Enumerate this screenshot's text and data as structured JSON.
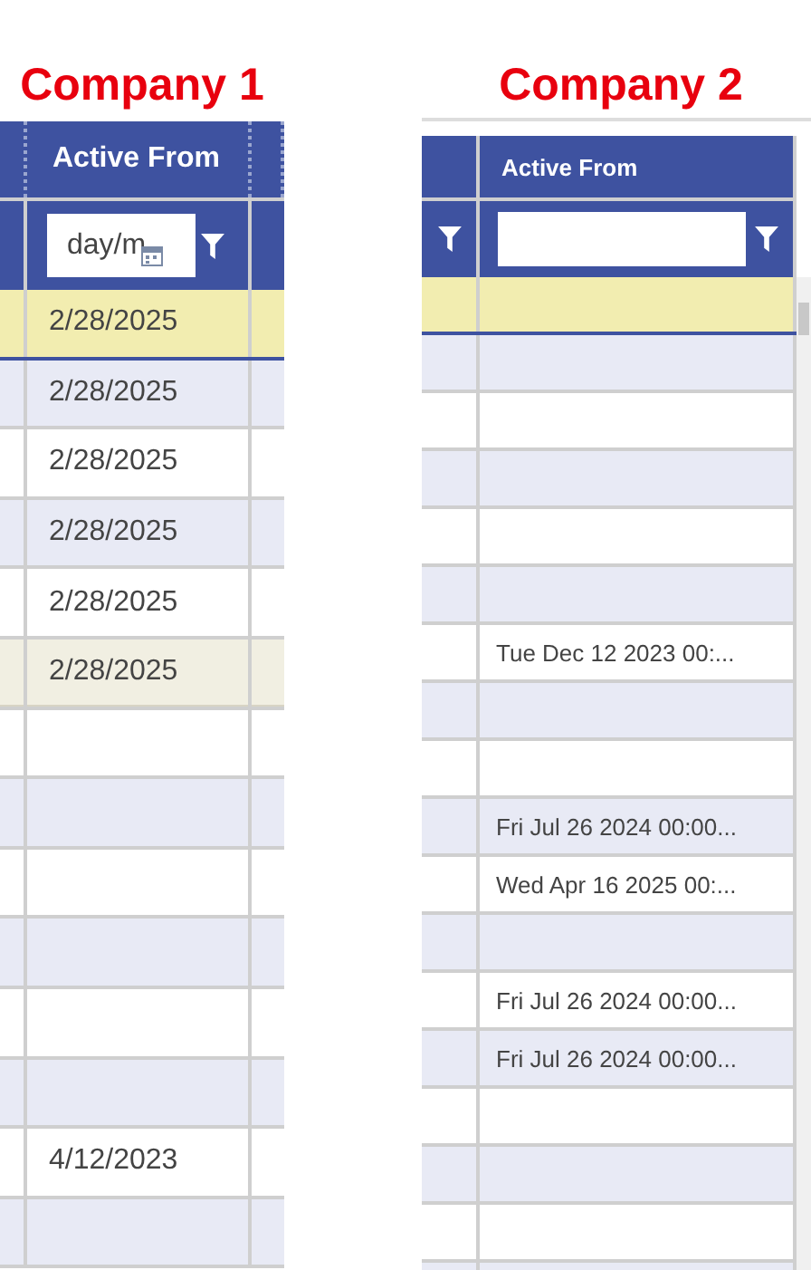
{
  "grids": [
    {
      "title": "Company 1",
      "columns": [
        {
          "label": "Active From"
        }
      ],
      "filter": {
        "kind": "date",
        "placeholder": "day/m"
      },
      "rows": [
        {
          "active_from": "2/28/2025",
          "selected": true,
          "hovered": false
        },
        {
          "active_from": "2/28/2025",
          "selected": false,
          "hovered": false
        },
        {
          "active_from": "2/28/2025",
          "selected": false,
          "hovered": false
        },
        {
          "active_from": "2/28/2025",
          "selected": false,
          "hovered": false
        },
        {
          "active_from": "2/28/2025",
          "selected": false,
          "hovered": false
        },
        {
          "active_from": "2/28/2025",
          "selected": false,
          "hovered": true
        },
        {
          "selected": false,
          "hovered": false
        },
        {
          "selected": false,
          "hovered": false
        },
        {
          "selected": false,
          "hovered": false
        },
        {
          "selected": false,
          "hovered": false
        },
        {
          "selected": false,
          "hovered": false
        },
        {
          "selected": false,
          "hovered": false
        },
        {
          "active_from": "4/12/2023",
          "selected": false,
          "hovered": false
        },
        {
          "selected": false,
          "hovered": false
        }
      ]
    },
    {
      "title": "Company 2",
      "columns": [
        {
          "label": "Active From"
        }
      ],
      "filter": {
        "kind": "text"
      },
      "rows": [
        {
          "selected": true,
          "hovered": false
        },
        {
          "selected": false,
          "hovered": false
        },
        {
          "selected": false,
          "hovered": false
        },
        {
          "selected": false,
          "hovered": false
        },
        {
          "selected": false,
          "hovered": false
        },
        {
          "selected": false,
          "hovered": false
        },
        {
          "active_from": "Tue Dec 12 2023 00:...",
          "selected": false,
          "hovered": false
        },
        {
          "selected": false,
          "hovered": false
        },
        {
          "selected": false,
          "hovered": false
        },
        {
          "active_from": "Fri Jul 26 2024 00:00...",
          "selected": false,
          "hovered": false
        },
        {
          "active_from": "Wed Apr 16 2025 00:...",
          "selected": false,
          "hovered": false
        },
        {
          "selected": false,
          "hovered": false
        },
        {
          "active_from": "Fri Jul 26 2024 00:00...",
          "selected": false,
          "hovered": false
        },
        {
          "active_from": "Fri Jul 26 2024 00:00...",
          "selected": false,
          "hovered": false
        },
        {
          "selected": false,
          "hovered": false
        },
        {
          "selected": false,
          "hovered": false
        },
        {
          "selected": false,
          "hovered": false
        },
        {
          "selected": false,
          "hovered": false
        }
      ]
    }
  ]
}
